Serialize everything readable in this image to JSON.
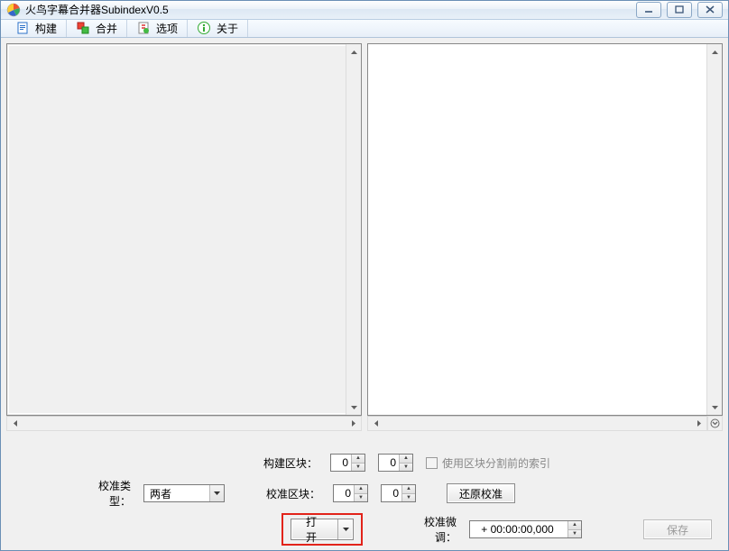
{
  "window": {
    "title": "火鸟字幕合并器SubindexV0.5"
  },
  "toolbar": {
    "build": "构建",
    "merge": "合并",
    "options": "选项",
    "about": "关于"
  },
  "controls": {
    "build_block_label": "构建区块：",
    "build_block_a": "0",
    "build_block_b": "0",
    "use_presplit_index_label": "使用区块分割前的索引",
    "calib_type_label": "校准类型：",
    "calib_type_value": "两者",
    "calib_block_label": "校准区块：",
    "calib_block_a": "0",
    "calib_block_b": "0",
    "restore_calib": "还原校准",
    "open": "打开",
    "calib_fine_label": "校准微调：",
    "calib_fine_value": "+ 00:00:00,000",
    "save": "保存"
  }
}
